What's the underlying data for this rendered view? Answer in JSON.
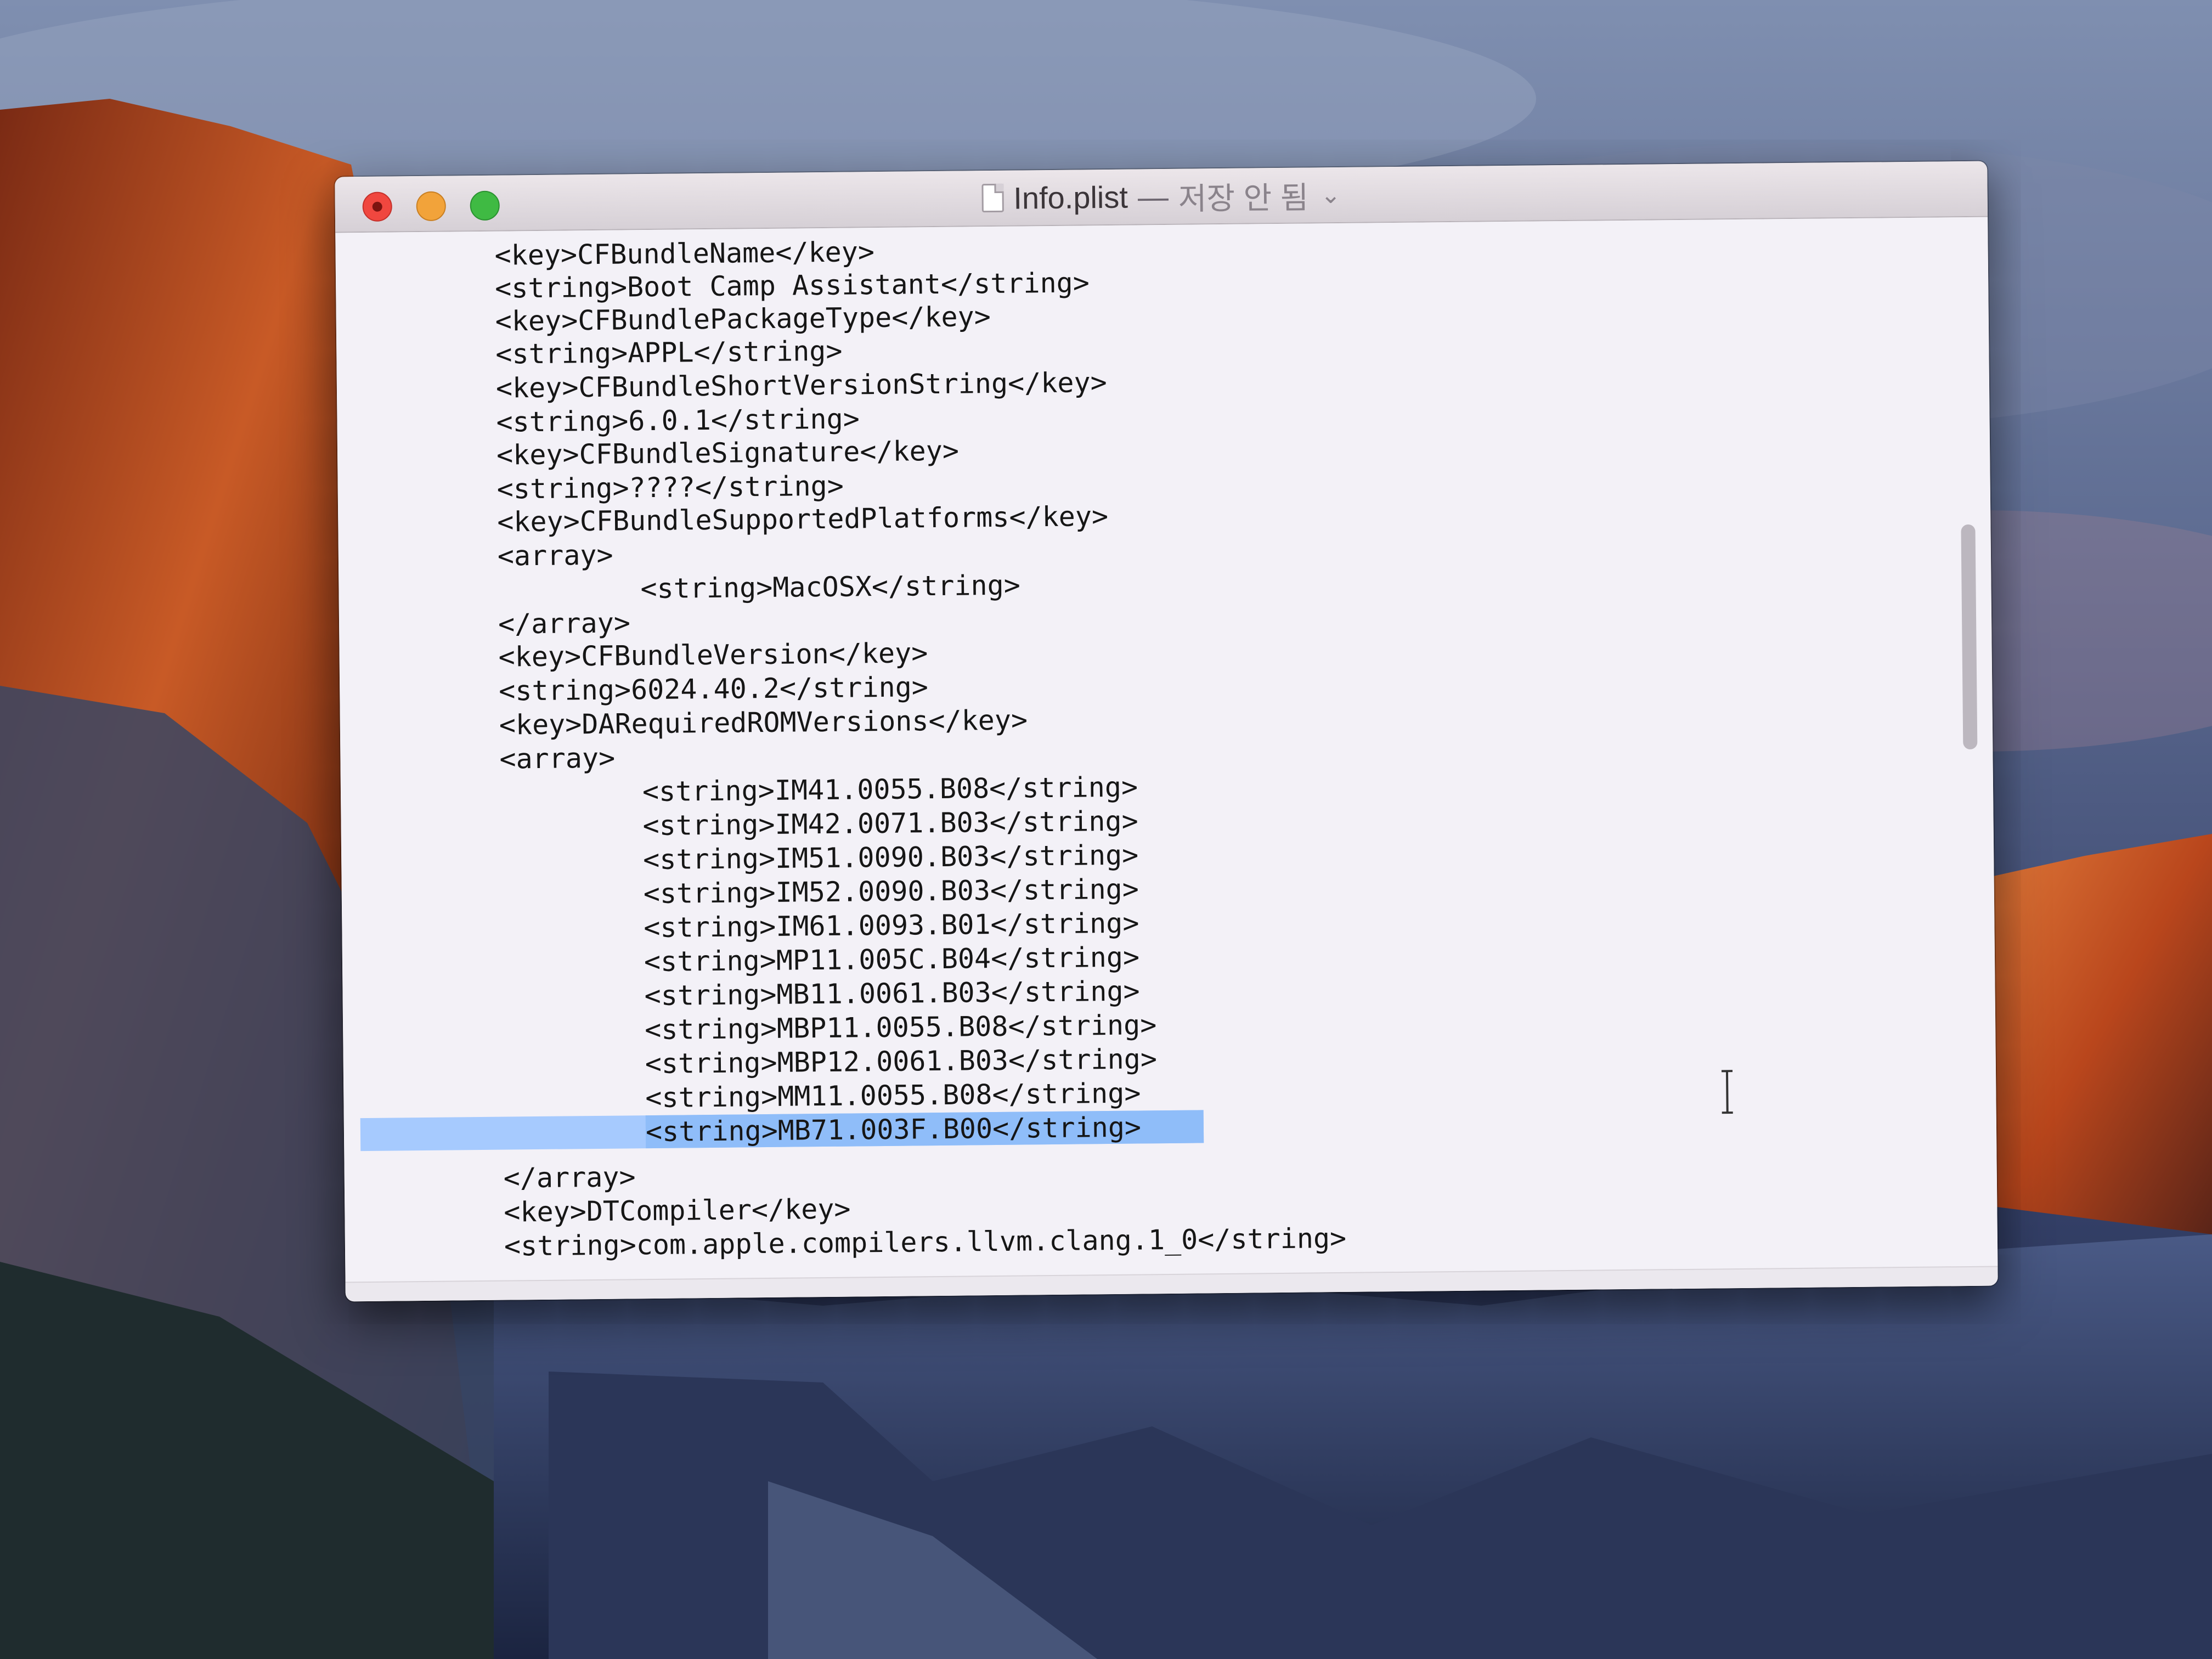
{
  "window": {
    "title": "Info.plist",
    "separator": "—",
    "status": "저장 안 됨",
    "chevron": "⌄"
  },
  "editor": {
    "lines": [
      "<key>CFBundleName</key>",
      "<string>Boot Camp Assistant</string>",
      "<key>CFBundlePackageType</key>",
      "<string>APPL</string>",
      "<key>CFBundleShortVersionString</key>",
      "<string>6.0.1</string>",
      "<key>CFBundleSignature</key>",
      "<string>????</string>",
      "<key>CFBundleSupportedPlatforms</key>",
      "<array>",
      "<string>MacOSX</string>",
      "</array>",
      "<key>CFBundleVersion</key>",
      "<string>6024.40.2</string>",
      "<key>DARequiredROMVersions</key>",
      "<array>",
      "<string>IM41.0055.B08</string>",
      "<string>IM42.0071.B03</string>",
      "<string>IM51.0090.B03</string>",
      "<string>IM52.0090.B03</string>",
      "<string>IM61.0093.B01</string>",
      "<string>MP11.005C.B04</string>",
      "<string>MB11.0061.B03</string>",
      "<string>MBP11.0055.B08</string>",
      "<string>MBP12.0061.B03</string>",
      "<string>MM11.0055.B08</string>",
      "<string>MB71.003F.B00</string>",
      "</array>",
      "<key>DTCompiler</key>",
      "<string>com.apple.compilers.llvm.clang.1_0</string>"
    ]
  },
  "colors": {
    "selection": "#a6cafe",
    "close": "#f0473f",
    "minimize": "#f2a33a",
    "zoom": "#3fba43"
  }
}
